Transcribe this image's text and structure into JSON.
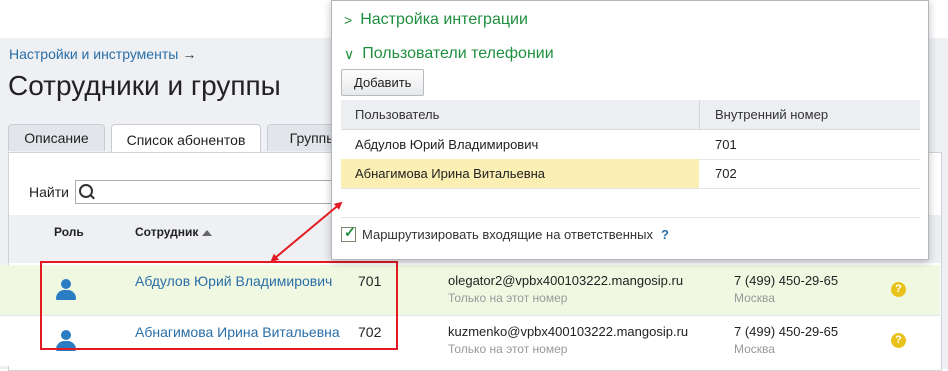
{
  "breadcrumb": {
    "label": "Настройки и инструменты",
    "arrow": "→"
  },
  "page_title": "Сотрудники и группы",
  "tabs": [
    {
      "label": "Описание"
    },
    {
      "label": "Список абонентов"
    },
    {
      "label": "Группы"
    }
  ],
  "search": {
    "label": "Найти",
    "value": ""
  },
  "table": {
    "columns": {
      "role": "Роль",
      "employee": "Сотрудник"
    },
    "rows": [
      {
        "name": "Абдулов Юрий Владимирович",
        "ext": "701",
        "email": "olegator2@vpbx400103222.mangosip.ru",
        "email_note": "Только на этот номер",
        "phone": "7 (499) 450-29-65",
        "city": "Москва",
        "help": "?"
      },
      {
        "name": "Абнагимова Ирина Витальевна",
        "ext": "702",
        "email": "kuzmenko@vpbx400103222.mangosip.ru",
        "email_note": "Только на этот номер",
        "phone": "7 (499) 450-29-65",
        "city": "Москва",
        "help": "?"
      }
    ]
  },
  "popup": {
    "section_integration": {
      "chevron": ">",
      "label": "Настройка интеграции"
    },
    "section_users": {
      "chevron": "∨",
      "label": "Пользователи телефонии"
    },
    "add_button": "Добавить",
    "columns": {
      "user": "Пользователь",
      "ext": "Внутренний номер"
    },
    "rows": [
      {
        "user": "Абдулов Юрий Владимирович",
        "ext": "701"
      },
      {
        "user": "Абнагимова Ирина Витальевна",
        "ext": "702"
      }
    ],
    "route_checkbox": {
      "label": "Маршрутизировать входящие на ответственных",
      "checked": true,
      "help": "?"
    }
  },
  "colors": {
    "accent_green": "#1f8f3f",
    "link_blue": "#2a6ea8",
    "highlight_red": "#e31b23",
    "row_selected": "#fbefb3"
  }
}
